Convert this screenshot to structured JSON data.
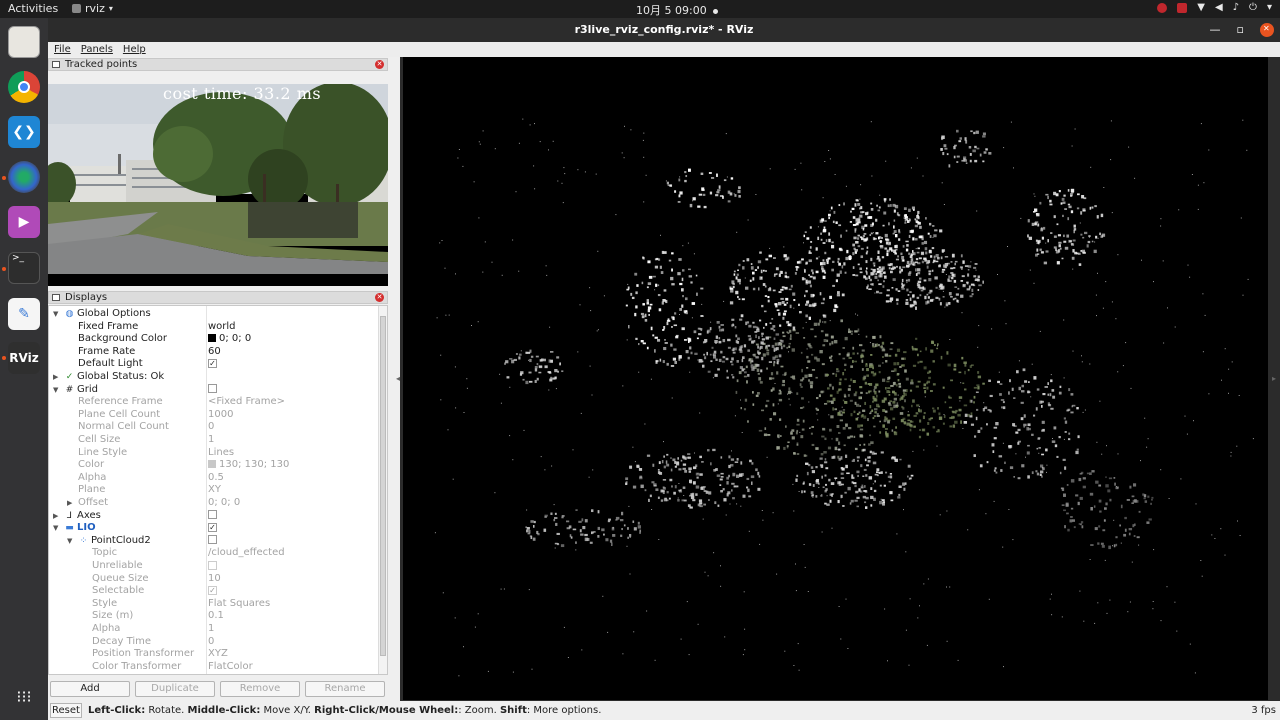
{
  "topbar": {
    "activities": "Activities",
    "app": "rviz",
    "clock": "10月 5  09:00"
  },
  "dock": {
    "items": [
      "files-icon",
      "chrome-icon",
      "vscode-icon",
      "color-icon",
      "video-icon",
      "terminal-icon",
      "editor-icon",
      "rviz-icon",
      "app-grid-icon"
    ],
    "rviz_label": "RViz"
  },
  "window": {
    "title": "r3live_rviz_config.rviz* - RViz"
  },
  "menu": {
    "file": "File",
    "panels": "Panels",
    "help": "Help"
  },
  "tracked_points": {
    "title": "Tracked points",
    "overlay": "cost time: 33.2 ms"
  },
  "displays": {
    "title": "Displays",
    "rows": [
      {
        "key": "Global Options",
        "value": ""
      },
      {
        "key": "Fixed Frame",
        "value": "world"
      },
      {
        "key": "Background Color",
        "value": "0; 0; 0"
      },
      {
        "key": "Frame Rate",
        "value": "60"
      },
      {
        "key": "Default Light",
        "value": ""
      },
      {
        "key": "Global Status: Ok",
        "value": ""
      },
      {
        "key": "Grid",
        "value": ""
      },
      {
        "key": "Reference Frame",
        "value": "<Fixed Frame>"
      },
      {
        "key": "Plane Cell Count",
        "value": "1000"
      },
      {
        "key": "Normal Cell Count",
        "value": "0"
      },
      {
        "key": "Cell Size",
        "value": "1"
      },
      {
        "key": "Line Style",
        "value": "Lines"
      },
      {
        "key": "Color",
        "value": "130; 130; 130"
      },
      {
        "key": "Alpha",
        "value": "0.5"
      },
      {
        "key": "Plane",
        "value": "XY"
      },
      {
        "key": "Offset",
        "value": "0; 0; 0"
      },
      {
        "key": "Axes",
        "value": ""
      },
      {
        "key": "LIO",
        "value": ""
      },
      {
        "key": "PointCloud2",
        "value": ""
      },
      {
        "key": "Topic",
        "value": "/cloud_effected"
      },
      {
        "key": "Unreliable",
        "value": ""
      },
      {
        "key": "Queue Size",
        "value": "10"
      },
      {
        "key": "Selectable",
        "value": ""
      },
      {
        "key": "Style",
        "value": "Flat Squares"
      },
      {
        "key": "Size (m)",
        "value": "0.1"
      },
      {
        "key": "Alpha",
        "value": "1"
      },
      {
        "key": "Decay Time",
        "value": "0"
      },
      {
        "key": "Position Transformer",
        "value": "XYZ"
      },
      {
        "key": "Color Transformer",
        "value": "FlatColor"
      }
    ]
  },
  "buttons": {
    "add": "Add",
    "duplicate": "Duplicate",
    "remove": "Remove",
    "rename": "Rename",
    "reset": "Reset"
  },
  "status": {
    "left_click": "Left-Click:",
    "left_click_desc": " Rotate. ",
    "middle_click": "Middle-Click:",
    "middle_click_desc": " Move X/Y. ",
    "right_click": "Right-Click/Mouse Wheel:",
    "right_click_desc": ": Zoom. ",
    "shift": "Shift",
    "shift_desc": ": More options.",
    "fps": "3 fps"
  },
  "colors": {
    "ubuntu_orange": "#e95420",
    "viewport_bg": "#000000",
    "lio_blue": "#1f5fbf"
  }
}
